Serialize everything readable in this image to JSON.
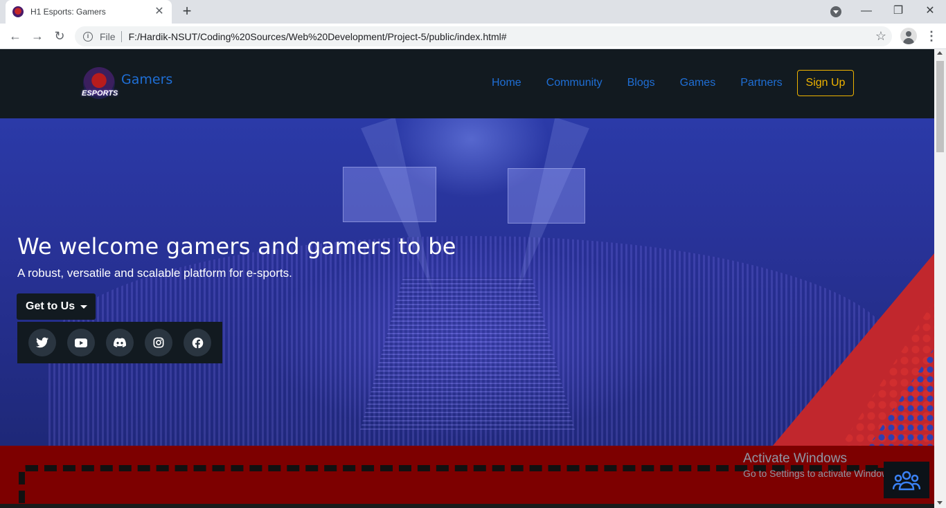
{
  "browser": {
    "tab_title": "H1 Esports: Gamers",
    "tab_close": "✕",
    "new_tab": "+",
    "url_scheme": "File",
    "url": "F:/Hardik-NSUT/Coding%20Sources/Web%20Development/Project-5/public/index.html#",
    "window_controls": {
      "minimize": "—",
      "restore": "❐",
      "close": "✕"
    },
    "nav": {
      "back": "←",
      "forward": "→",
      "reload": "↻"
    },
    "bookmark_star": "☆",
    "menu": "⋮"
  },
  "site": {
    "logo_text": "ESPORTS",
    "brand": "Gamers",
    "nav_links": [
      "Home",
      "Community",
      "Blogs",
      "Games",
      "Partners"
    ],
    "signup_label": "Sign Up"
  },
  "hero": {
    "title": "We welcome gamers and gamers to be",
    "subtitle": "A robust, versatile and scalable platform for e-sports.",
    "dropdown_label": "Get to Us",
    "social_icons": [
      "twitter-icon",
      "youtube-icon",
      "discord-icon",
      "instagram-icon",
      "facebook-icon"
    ]
  },
  "overlay": {
    "activate_title": "Activate Windows",
    "activate_sub": "Go to Settings to activate Windows."
  },
  "colors": {
    "nav_bg": "#121a20",
    "link_blue": "#1f6fd6",
    "signup_gold": "#f0b400",
    "hero_blue": "#2b3aa8",
    "section_red": "#7d0000"
  }
}
